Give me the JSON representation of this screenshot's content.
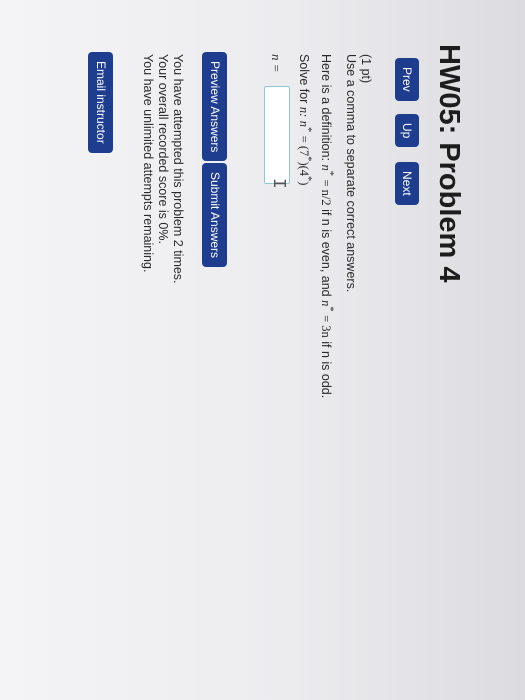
{
  "header": {
    "title": "HW05: Problem 4"
  },
  "nav": {
    "prev_label": "Prev",
    "up_label": "Up",
    "next_label": "Next"
  },
  "problem": {
    "points": "(1 pt)",
    "instruction": "Use a comma to separate correct answers.",
    "definition_prefix": "Here is a definition:",
    "def_n1": "n",
    "def_eq1": "= n/2",
    "def_mid": "if n is even, and",
    "def_n2": "n",
    "def_eq2": "= 3n",
    "def_end": "if n is odd.",
    "star": "*",
    "solve_prefix": "Solve for",
    "solve_var": "n:",
    "solve_n": "n",
    "solve_eq": "= (7",
    "solve_mid": ")(4",
    "solve_close": ")",
    "answer_label": "n =",
    "answer_value": "",
    "cursor_glyph": "I"
  },
  "actions": {
    "preview_label": "Preview Answers",
    "submit_label": "Submit Answers",
    "email_label": "Email instructor"
  },
  "status": {
    "attempts": "You have attempted this problem 2 times.",
    "score": "Your overall recorded score is 0%.",
    "remaining": "You have unlimited attempts remaining."
  },
  "colors": {
    "button_bg": "#1e3d8f",
    "input_border": "#8ec8d6"
  }
}
